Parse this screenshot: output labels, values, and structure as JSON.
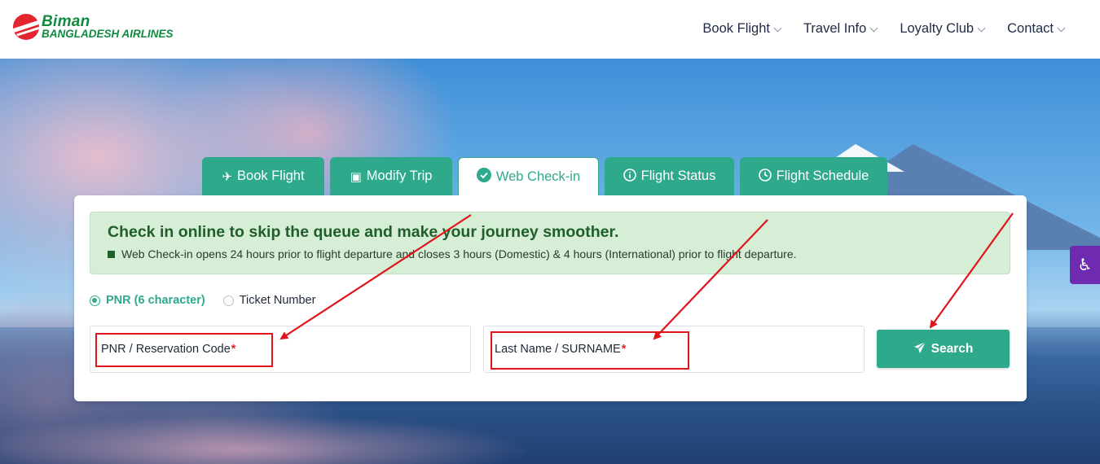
{
  "header": {
    "logo_line1": "Biman",
    "logo_line2": "BANGLADESH AIRLINES",
    "nav": [
      {
        "label": "Book Flight"
      },
      {
        "label": "Travel Info"
      },
      {
        "label": "Loyalty Club"
      },
      {
        "label": "Contact"
      }
    ]
  },
  "tabs": [
    {
      "label": "Book Flight",
      "icon": "plane-icon"
    },
    {
      "label": "Modify Trip",
      "icon": "luggage-icon"
    },
    {
      "label": "Web Check-in",
      "icon": "check-circle-icon",
      "active": true
    },
    {
      "label": "Flight Status",
      "icon": "info-icon"
    },
    {
      "label": "Flight Schedule",
      "icon": "clock-icon"
    }
  ],
  "notice": {
    "title": "Check in online to skip the queue and make your journey smoother.",
    "body": "Web Check-in opens 24 hours prior to flight departure and closes 3 hours (Domestic) & 4 hours (International) prior to flight departure."
  },
  "search_type": {
    "options": [
      {
        "label": "PNR (6 character)",
        "selected": true
      },
      {
        "label": "Ticket Number",
        "selected": false
      }
    ]
  },
  "form": {
    "pnr_label": "PNR / Reservation Code",
    "lastname_label": "Last Name / SURNAME",
    "required_mark": "*",
    "search_label": "Search"
  },
  "colors": {
    "accent": "#2ea98c",
    "brand_green": "#0f8a3e",
    "brand_red": "#e3262e",
    "notice_bg": "#d6edd6",
    "annotation_red": "#e0141b",
    "accessibility": "#6f2bb0"
  }
}
